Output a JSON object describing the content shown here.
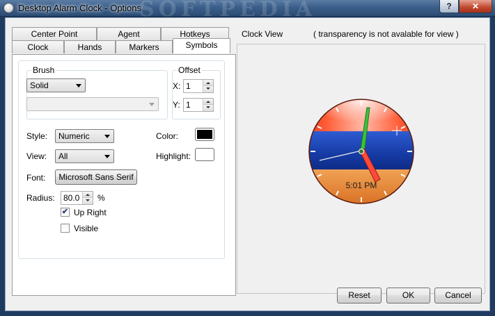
{
  "window": {
    "title": "Desktop Alarm Clock - Options",
    "help_glyph": "?",
    "close_glyph": "✕",
    "watermark": "SOFTPEDIA"
  },
  "tabs": {
    "row_back": [
      "Center Point",
      "Agent",
      "Hotkeys"
    ],
    "row_front": [
      "Clock",
      "Hands",
      "Markers",
      "Symbols"
    ],
    "active": "Symbols"
  },
  "brush": {
    "group_label": "Brush",
    "selected": "Solid",
    "secondary": ""
  },
  "offset": {
    "group_label": "Offset",
    "x_label": "X:",
    "x_value": "1",
    "y_label": "Y:",
    "y_value": "1"
  },
  "style": {
    "label": "Style:",
    "selected": "Numeric"
  },
  "view": {
    "label": "View:",
    "selected": "All"
  },
  "color": {
    "label": "Color:",
    "value": "#000000"
  },
  "highlight": {
    "label": "Highlight:",
    "value": "#ffffff"
  },
  "font": {
    "label": "Font:",
    "button": "Microsoft Sans Serif"
  },
  "radius": {
    "label": "Radius:",
    "value": "80.0",
    "unit": "%"
  },
  "checks": {
    "up_right": {
      "label": "Up Right",
      "checked": true
    },
    "visible": {
      "label": "Visible",
      "checked": false
    }
  },
  "clock_view": {
    "label": "Clock View",
    "note": "( transparency is not avalable for view )",
    "time": "5:01 PM"
  },
  "buttons": {
    "reset": "Reset",
    "ok": "OK",
    "cancel": "Cancel"
  }
}
